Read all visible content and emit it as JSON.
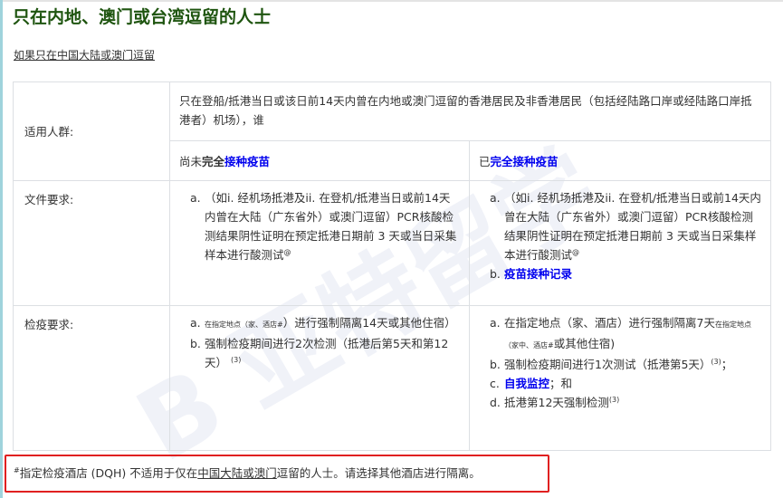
{
  "title": "只在内地、澳门或台湾逗留的人士",
  "subtitle_link": "如果只在中国大陆或澳门逗留",
  "table": {
    "row_applicable": {
      "label": "适用人群:",
      "text": "只在登船/抵港当日或该日前14天内曾在内地或澳门逗留的香港居民及非香港居民（包括经陆路口岸或经陆路口岸抵港者）机场），谁"
    },
    "col_unvaccinated": {
      "prefix": "尚未",
      "bold": "完全",
      "link": "接种疫苗"
    },
    "col_vaccinated": {
      "prefix": "已",
      "link": "完全接种疫苗"
    },
    "row_documents": {
      "label": "文件要求:",
      "unvaccinated": [
        {
          "marker": "a.",
          "text": "（如i. 经机场抵港及ii. 在登机/抵港当日或前14天内曾在大陆（广东省外）或澳门逗留）PCR核酸检测结果阴性证明在预定抵港日期前 3 天或当日采集样本进行酸测试",
          "sup": "@"
        }
      ],
      "vaccinated": [
        {
          "marker": "a.",
          "text": "（如i. 经机场抵港及ii. 在登机/抵港当日或前14天内曾在大陆（广东省外）或澳门逗留）PCR核酸检测结果阴性证明在预定抵港日期前 3 天或当日采集样本进行酸测试",
          "sup": "@"
        },
        {
          "marker": "b.",
          "link": "疫苗接种记录"
        }
      ]
    },
    "row_quarantine": {
      "label": "检疫要求:",
      "unvaccinated": [
        {
          "marker": "a.",
          "small": "在指定地点（家、酒店#",
          "text": "）进行强制隔离14天或其他住宿）"
        },
        {
          "marker": "b.",
          "text": "强制检疫期间进行2次检测（抵港后第5天和第12天）",
          "sup": "(3)"
        }
      ],
      "vaccinated": [
        {
          "marker": "a.",
          "text": "在指定地点（家、酒店）进行强制隔离7天",
          "small": "在指定地点（家中、酒店#",
          "text2": "或其他住宿)"
        },
        {
          "marker": "b.",
          "text": "强制检疫期间进行1次测试（抵港第5天）",
          "sup": "(3)",
          "tail": "；"
        },
        {
          "marker": "c.",
          "link": "自我监控",
          "text": "；和"
        },
        {
          "marker": "d.",
          "text": "抵港第12天强制检测",
          "sup": "(3)"
        }
      ]
    }
  },
  "note": {
    "sup": "#",
    "pre": "指定检疫酒店 (DQH) 不适用于仅在",
    "link": "中国大陆或澳门",
    "post": "逗留的人士。请选择其他酒店进行隔离。"
  }
}
